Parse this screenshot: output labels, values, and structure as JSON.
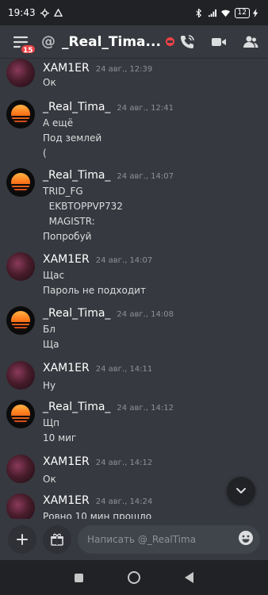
{
  "status_bar": {
    "time": "19:43",
    "battery": "12"
  },
  "header": {
    "badge_count": "15",
    "at_symbol": "@",
    "title": "_Real_Timа..."
  },
  "messages": [
    {
      "author": "XAM1ER",
      "time": "24 авг., 12:39",
      "avatar": "xamier-avatar",
      "lines": [
        "Ок"
      ]
    },
    {
      "author": "_Real_Tima_",
      "time": "24 авг., 12:41",
      "avatar": "tima-avatar",
      "lines": [
        "А ещё",
        "Под землей",
        "("
      ]
    },
    {
      "author": "_Real_Tima_",
      "time": "24 авг., 14:07",
      "avatar": "tima-avatar",
      "lines": [
        "TRID_FG",
        "  EKBTOPPVP732",
        "  MAGISTR:",
        "Попробуй"
      ]
    },
    {
      "author": "XAM1ER",
      "time": "24 авг., 14:07",
      "avatar": "xamier-avatar",
      "lines": [
        "Щас",
        "Пароль не подходит"
      ]
    },
    {
      "author": "_Real_Tima_",
      "time": "24 авг., 14:08",
      "avatar": "tima-avatar",
      "lines": [
        "Бл",
        "Ща"
      ]
    },
    {
      "author": "XAM1ER",
      "time": "24 авг., 14:11",
      "avatar": "xamier-avatar",
      "lines": [
        "Ну"
      ]
    },
    {
      "author": "_Real_Tima_",
      "time": "24 авг., 14:12",
      "avatar": "tima-avatar",
      "lines": [
        "Щп",
        "10 миг"
      ]
    },
    {
      "author": "XAM1ER",
      "time": "24 авг., 14:12",
      "avatar": "xamier-avatar",
      "lines": [
        "Ок"
      ]
    },
    {
      "author": "XAM1ER",
      "time": "24 авг., 14:24",
      "avatar": "xamier-avatar",
      "lines": [
        "Ровно 10 мин прошло"
      ]
    }
  ],
  "composer": {
    "placeholder": "Написать @_RealTima"
  },
  "colors": {
    "background": "#36393f",
    "status_bar": "#202225",
    "badge": "#ed4245",
    "input": "#40444b"
  },
  "icons": [
    "menu-icon",
    "at-icon",
    "dnd-status-icon",
    "call-icon",
    "video-icon",
    "members-icon",
    "chevron-down-icon",
    "plus-icon",
    "gift-icon",
    "emoji-icon"
  ]
}
